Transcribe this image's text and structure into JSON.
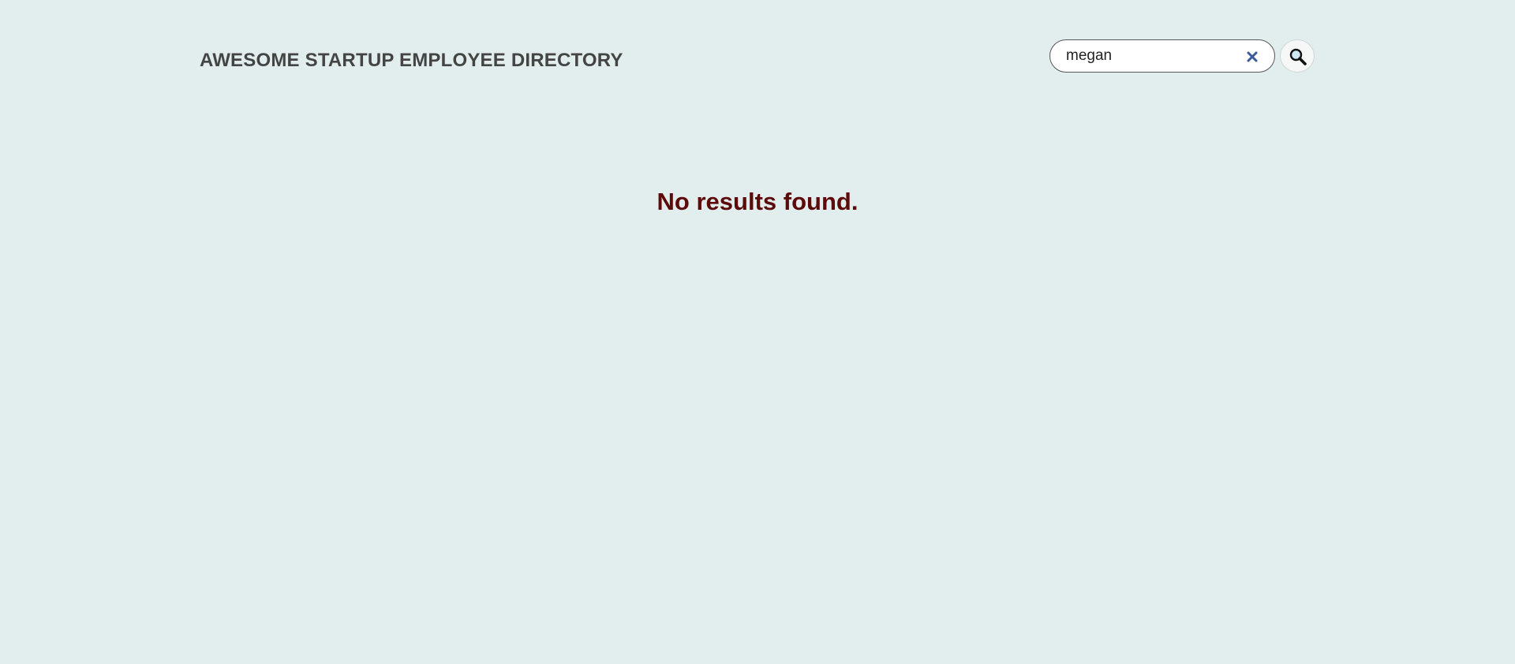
{
  "header": {
    "title": "AWESOME STARTUP EMPLOYEE DIRECTORY"
  },
  "search": {
    "value": "megan",
    "clear_icon": "close-icon",
    "button_icon": "search-icon"
  },
  "results": {
    "message": "No results found."
  },
  "colors": {
    "background": "#e2eeee",
    "title": "#444444",
    "message": "#5c0a0a",
    "clear_icon": "#3a5a9a"
  }
}
